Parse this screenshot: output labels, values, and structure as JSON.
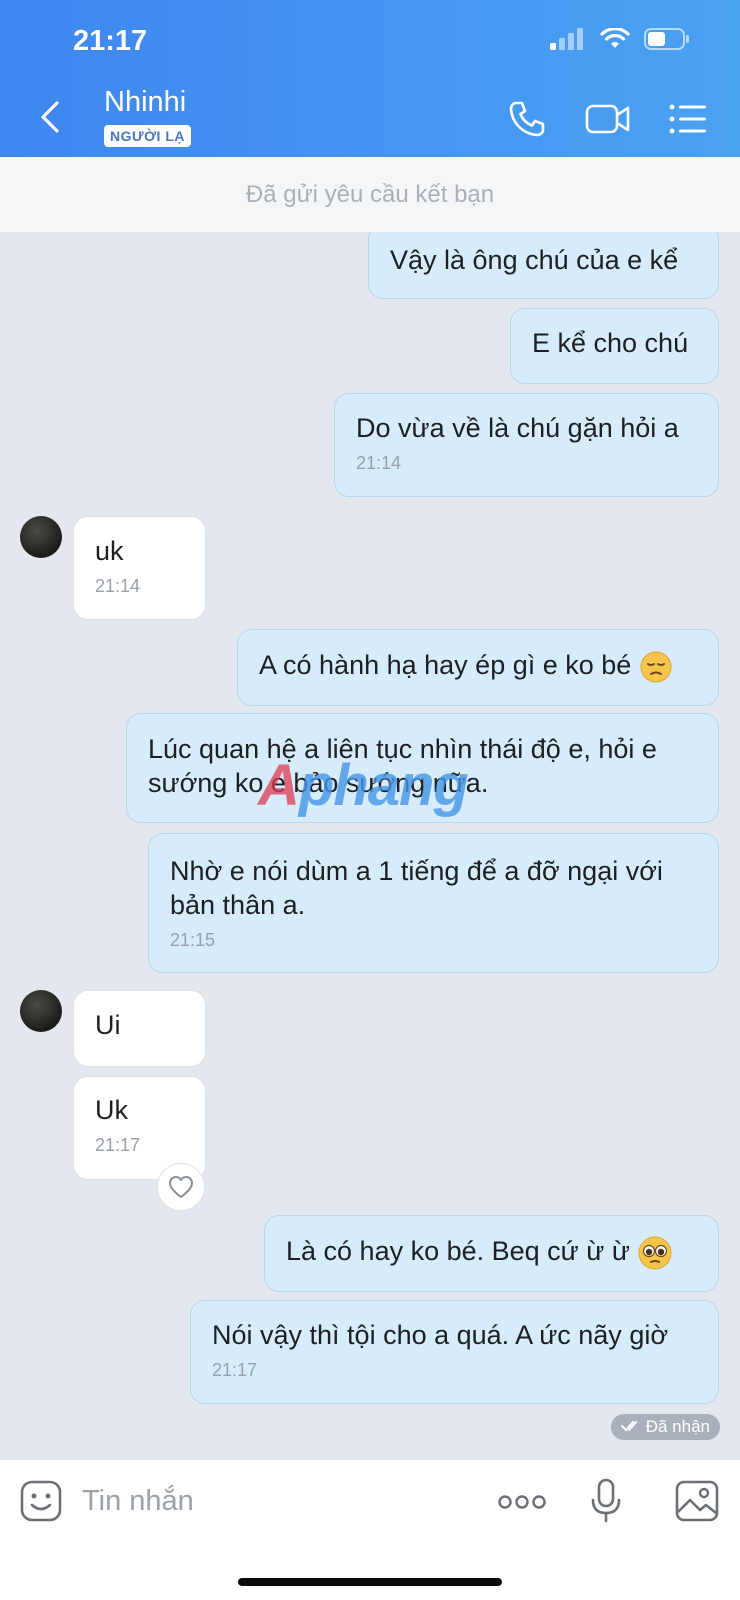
{
  "status_bar": {
    "time": "21:17"
  },
  "header": {
    "title": "Nhinhi",
    "badge": "NGƯỜI LẠ"
  },
  "banner": {
    "text": "Đã gửi yêu cầu kết bạn"
  },
  "messages": [
    {
      "text": "Vậy là ông chú của e kể"
    },
    {
      "text": "E kể cho chú"
    },
    {
      "text": "Do vừa về là chú gặn hỏi a",
      "time": "21:14"
    },
    {
      "text": "uk",
      "time": "21:14"
    },
    {
      "text": "A có hành hạ hay ép gì e ko bé",
      "emoji": "pensive-face"
    },
    {
      "text": "Lúc quan hệ a liên tục nhìn thái độ e, hỏi e sướng ko e bảo sướng nữa."
    },
    {
      "text": "Nhờ e nói dùm a 1 tiếng để a đỡ ngại với bản thân a.",
      "time": "21:15"
    },
    {
      "text": "Ui"
    },
    {
      "text": "Uk",
      "time": "21:17"
    },
    {
      "text": "Là có hay ko bé. Beq cứ ừ ừ",
      "emoji": "pleading-face"
    },
    {
      "text": "Nói vậy thì tội cho a quá. A ức nãy giờ",
      "time": "21:17"
    }
  ],
  "delivered": "Đã nhận",
  "watermark": {
    "part1": "A",
    "part2": "phang"
  },
  "input": {
    "placeholder": "Tin nhắn"
  }
}
